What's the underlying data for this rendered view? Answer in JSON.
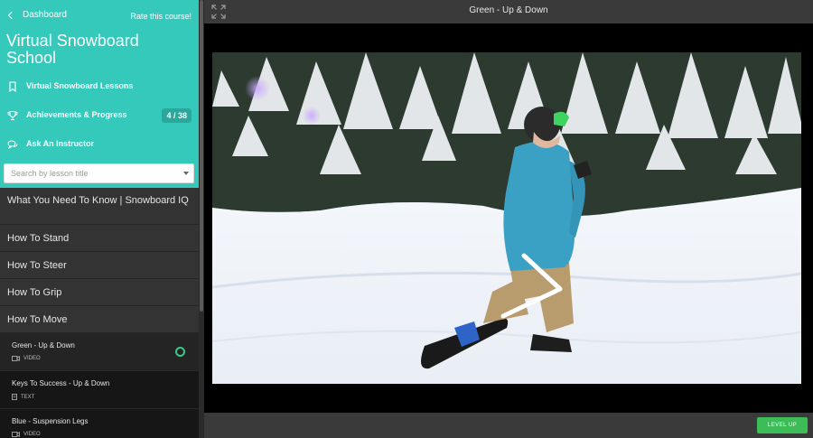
{
  "sidebar": {
    "back_label": "Dashboard",
    "rate_label": "Rate this course!",
    "course_title": "Virtual Snowboard School",
    "nav": [
      {
        "label": "Virtual Snowboard Lessons",
        "icon": "bookmark-icon"
      },
      {
        "label": "Achievements & Progress",
        "icon": "trophy-icon",
        "badge": "4 / 38"
      },
      {
        "label": "Ask An Instructor",
        "icon": "chat-icon"
      }
    ],
    "search": {
      "placeholder": "Search by lesson title",
      "value": ""
    },
    "sections": [
      "What You Need To Know | Snowboard IQ",
      "How To Stand",
      "How To Steer",
      "How To Grip",
      "How To Move"
    ],
    "lessons": [
      {
        "title": "Green - Up & Down",
        "kind": "VIDEO",
        "icon": "video-icon",
        "active": true,
        "status": "in-progress"
      },
      {
        "title": "Keys To Success - Up & Down",
        "kind": "TEXT",
        "icon": "document-icon",
        "active": false
      },
      {
        "title": "Blue - Suspension Legs",
        "kind": "VIDEO",
        "icon": "video-icon",
        "active": false
      }
    ]
  },
  "main": {
    "video_title": "Green - Up & Down",
    "level_up_label": "LEVEL UP"
  },
  "colors": {
    "accent": "#35c9bb",
    "badge": "#2aa89c",
    "level_up": "#3cbd58",
    "progress_ring": "#35c98a"
  }
}
